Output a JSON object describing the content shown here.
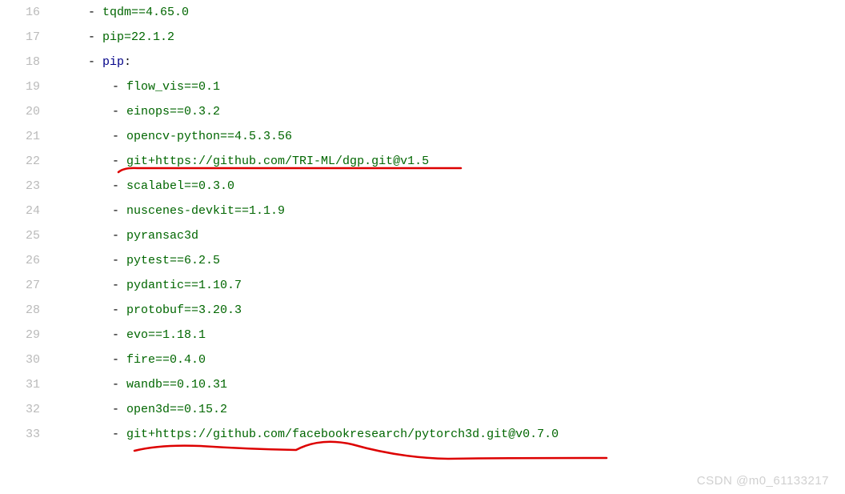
{
  "lines": [
    {
      "num": "16",
      "indent": 1,
      "prefix": "- ",
      "content": "tqdm==4.65.0",
      "tokenClass": "string"
    },
    {
      "num": "17",
      "indent": 1,
      "prefix": "- ",
      "content": "pip=22.1.2",
      "tokenClass": "string"
    },
    {
      "num": "18",
      "indent": 1,
      "prefix": "- ",
      "content": "pip",
      "tokenClass": "key",
      "suffix": ":"
    },
    {
      "num": "19",
      "indent": 2,
      "prefix": "- ",
      "content": "flow_vis==0.1",
      "tokenClass": "string"
    },
    {
      "num": "20",
      "indent": 2,
      "prefix": "- ",
      "content": "einops==0.3.2",
      "tokenClass": "string"
    },
    {
      "num": "21",
      "indent": 2,
      "prefix": "- ",
      "content": "opencv-python==4.5.3.56",
      "tokenClass": "string"
    },
    {
      "num": "22",
      "indent": 2,
      "prefix": "- ",
      "content": "git+https://github.com/TRI-ML/dgp.git@v1.5",
      "tokenClass": "string"
    },
    {
      "num": "23",
      "indent": 2,
      "prefix": "- ",
      "content": "scalabel==0.3.0",
      "tokenClass": "string"
    },
    {
      "num": "24",
      "indent": 2,
      "prefix": "- ",
      "content": "nuscenes-devkit==1.1.9",
      "tokenClass": "string"
    },
    {
      "num": "25",
      "indent": 2,
      "prefix": "- ",
      "content": "pyransac3d",
      "tokenClass": "string"
    },
    {
      "num": "26",
      "indent": 2,
      "prefix": "- ",
      "content": "pytest==6.2.5",
      "tokenClass": "string"
    },
    {
      "num": "27",
      "indent": 2,
      "prefix": "- ",
      "content": "pydantic==1.10.7",
      "tokenClass": "string"
    },
    {
      "num": "28",
      "indent": 2,
      "prefix": "- ",
      "content": "protobuf==3.20.3",
      "tokenClass": "string"
    },
    {
      "num": "29",
      "indent": 2,
      "prefix": "- ",
      "content": "evo==1.18.1",
      "tokenClass": "string"
    },
    {
      "num": "30",
      "indent": 2,
      "prefix": "- ",
      "content": "fire==0.4.0",
      "tokenClass": "string"
    },
    {
      "num": "31",
      "indent": 2,
      "prefix": "- ",
      "content": "wandb==0.10.31",
      "tokenClass": "string"
    },
    {
      "num": "32",
      "indent": 2,
      "prefix": "- ",
      "content": "open3d==0.15.2",
      "tokenClass": "string"
    },
    {
      "num": "33",
      "indent": 2,
      "prefix": "- ",
      "content": "git+https://github.com/facebookresearch/pytorch3d.git@v0.7.0",
      "tokenClass": "string"
    }
  ],
  "watermark": "CSDN @m0_61133217",
  "annotationColor": "#dd0000"
}
